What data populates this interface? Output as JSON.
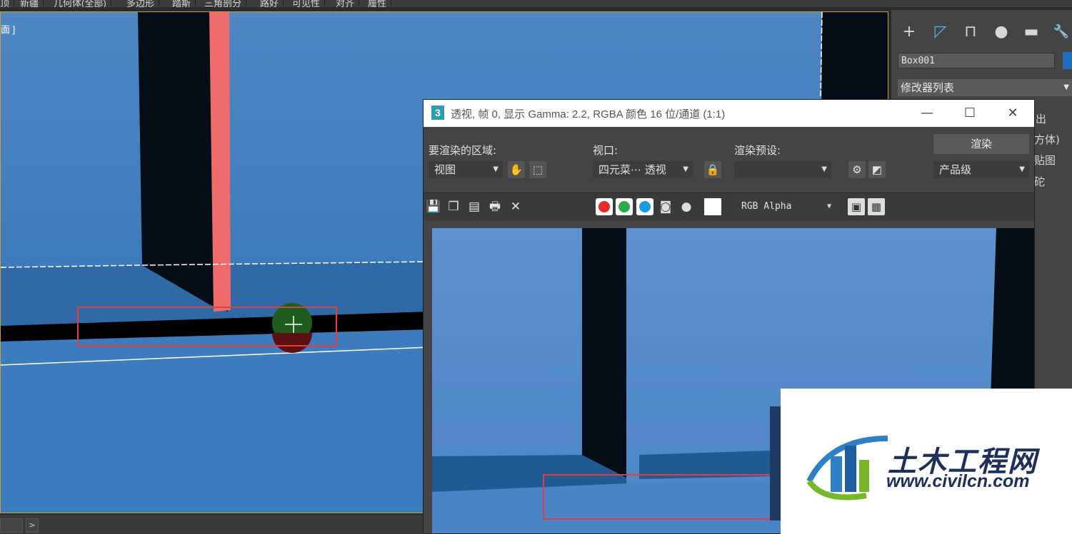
{
  "top_menu": {
    "items": [
      "顶",
      "新疆",
      "几何体(全部)",
      "多边形",
      "踏斯",
      "三角剖分",
      "路好",
      "可见性",
      "对齐",
      "履性"
    ]
  },
  "viewport": {
    "label": "面 ]",
    "statusbar": {
      "next_glyph": ">"
    }
  },
  "command_panel": {
    "tabs": [
      {
        "icon": "plus-icon",
        "glyph": "+"
      },
      {
        "icon": "modify-icon",
        "glyph": "◸"
      },
      {
        "icon": "hierarchy-icon",
        "glyph": "⊓"
      },
      {
        "icon": "motion-icon",
        "glyph": "●"
      },
      {
        "icon": "display-icon",
        "glyph": "▬"
      },
      {
        "icon": "utilities-icon",
        "glyph": "🔧"
      }
    ],
    "object_name": "Box001",
    "object_color": "#1e6fc4",
    "modifier_list": "修改器列表",
    "partial_labels": [
      "出",
      "方体)",
      "贴图",
      "砣"
    ]
  },
  "render_window": {
    "app_icon": "3",
    "title": "透视, 帧 0, 显示 Gamma: 2.2, RGBA 颜色 16 位/通道 (1:1)",
    "controls": {
      "minimize": "—",
      "maximize": "☐",
      "close": "✕"
    },
    "area_label": "要渲染的区域:",
    "area_value": "视图",
    "viewport_label": "视口:",
    "viewport_value": "四元菜⋯ 透视",
    "preset_label": "渲染预设:",
    "preset_value": "",
    "render_button": "渲染",
    "quality_value": "产品级",
    "channel_select": "RGB Alpha",
    "channels": [
      {
        "name": "red-channel",
        "color": "#e52b2b"
      },
      {
        "name": "green-channel",
        "color": "#2fa84a"
      },
      {
        "name": "blue-channel",
        "color": "#1f9ae0"
      }
    ]
  },
  "watermark": {
    "cn": "土木工程网",
    "url": "www.civilcn.com"
  }
}
